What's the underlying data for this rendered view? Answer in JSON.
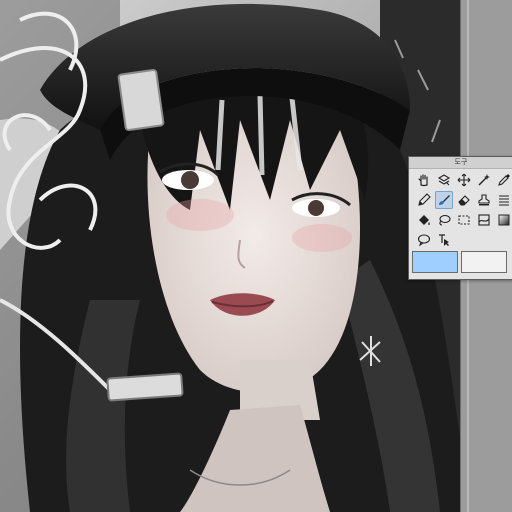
{
  "toolbox": {
    "title": "도구",
    "tools": [
      {
        "icon": "hand-icon"
      },
      {
        "icon": "layer-move-icon"
      },
      {
        "icon": "move-arrows-icon"
      },
      {
        "icon": "magic-wand-icon"
      },
      {
        "icon": "eyedropper-icon"
      },
      {
        "icon": "pen-icon"
      },
      {
        "icon": "brush-icon",
        "selected": true
      },
      {
        "icon": "eraser-icon"
      },
      {
        "icon": "stamp-icon"
      },
      {
        "icon": "hatching-icon"
      },
      {
        "icon": "fill-bucket-icon"
      },
      {
        "icon": "lasso-icon"
      },
      {
        "icon": "rect-select-icon"
      },
      {
        "icon": "transform-icon"
      },
      {
        "icon": "gradient-icon"
      },
      {
        "icon": "speech-bubble-icon"
      },
      {
        "icon": "text-select-icon"
      }
    ]
  },
  "colors": {
    "primary": "#9ecfff",
    "secondary": "#f2f2f2"
  }
}
